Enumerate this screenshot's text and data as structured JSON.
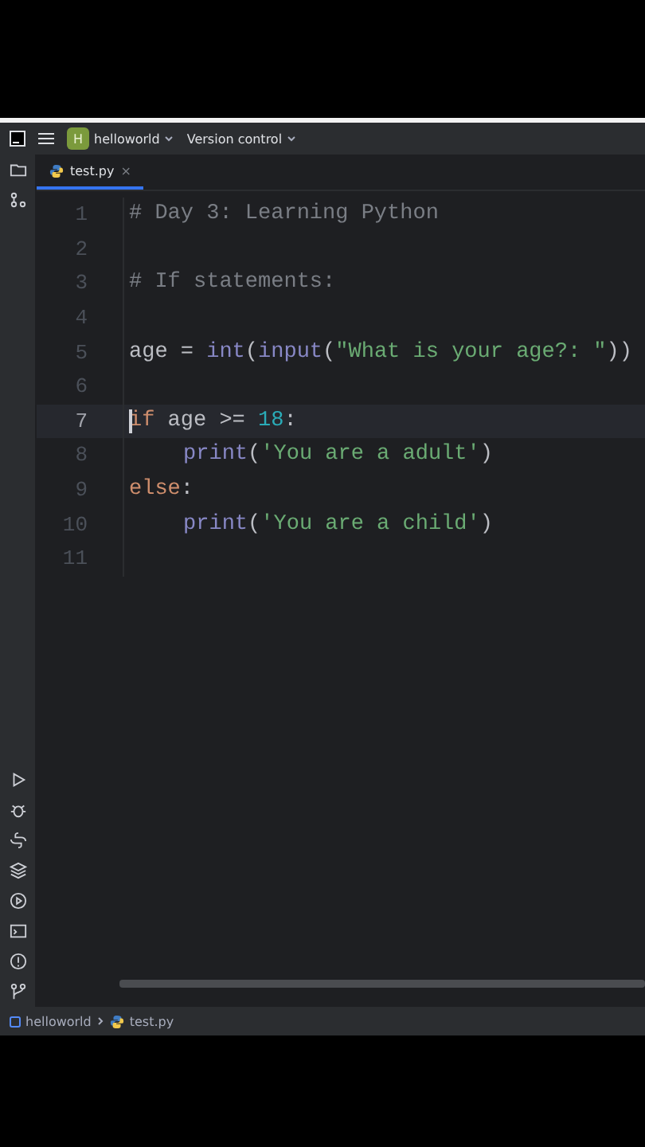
{
  "title_bar": {
    "project": {
      "initial": "H",
      "name": "helloworld"
    },
    "vcs": "Version control"
  },
  "tabs": [
    {
      "label": "test.py",
      "close": "×",
      "selected": true
    }
  ],
  "editor": {
    "lines": [
      {
        "number": "1",
        "current": false,
        "tokens": [
          {
            "text": "# Day 3: Learning Python",
            "kind": "comment"
          }
        ]
      },
      {
        "number": "2",
        "current": false
      },
      {
        "number": "3",
        "current": false,
        "tokens": [
          {
            "text": "# If statements:",
            "kind": "comment"
          }
        ]
      },
      {
        "number": "4",
        "current": false
      },
      {
        "number": "5",
        "current": false,
        "tokens": [
          {
            "text": "age = ",
            "kind": "plain"
          },
          {
            "text": "int",
            "kind": "builtin"
          },
          {
            "text": "(",
            "kind": "plain"
          },
          {
            "text": "input",
            "kind": "builtin"
          },
          {
            "text": "(",
            "kind": "plain"
          },
          {
            "text": "\"What is your age?: \"",
            "kind": "string"
          },
          {
            "text": "))",
            "kind": "plain"
          }
        ]
      },
      {
        "number": "6",
        "current": false
      },
      {
        "number": "7",
        "current": true,
        "tokens": [
          {
            "text": "if",
            "kind": "keyword"
          },
          {
            "text": " age >= ",
            "kind": "plain"
          },
          {
            "text": "18",
            "kind": "number"
          },
          {
            "text": ":",
            "kind": "plain"
          }
        ]
      },
      {
        "number": "8",
        "current": false,
        "indented": true,
        "tokens": [
          {
            "text": "print",
            "kind": "builtin"
          },
          {
            "text": "(",
            "kind": "plain"
          },
          {
            "text": "'You are a adult'",
            "kind": "string"
          },
          {
            "text": ")",
            "kind": "plain"
          }
        ]
      },
      {
        "number": "9",
        "current": false,
        "tokens": [
          {
            "text": "else",
            "kind": "keyword"
          },
          {
            "text": ":",
            "kind": "plain"
          }
        ]
      },
      {
        "number": "10",
        "current": false,
        "indented": true,
        "tokens": [
          {
            "text": "print",
            "kind": "builtin"
          },
          {
            "text": "(",
            "kind": "plain"
          },
          {
            "text": "'You are a child'",
            "kind": "string"
          },
          {
            "text": ")",
            "kind": "plain"
          }
        ]
      },
      {
        "number": "11",
        "current": false
      }
    ]
  },
  "breadcrumb": [
    {
      "label": "helloworld",
      "kind": "module"
    },
    {
      "label": "test.py",
      "kind": "file"
    }
  ]
}
